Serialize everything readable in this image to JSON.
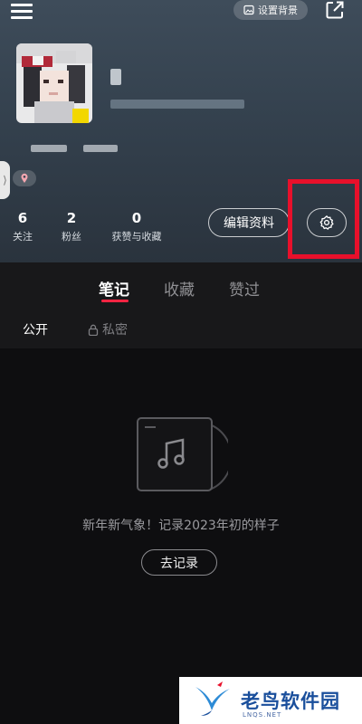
{
  "header": {
    "background_button_label": "设置背景",
    "menu_icon": "hamburger-menu-icon",
    "share_icon": "share-icon"
  },
  "stats": [
    {
      "value": "6",
      "label": "关注"
    },
    {
      "value": "2",
      "label": "粉丝"
    },
    {
      "value": "0",
      "label": "获赞与收藏"
    }
  ],
  "actions": {
    "edit_profile_label": "编辑资料",
    "settings_icon": "gear-icon"
  },
  "tabs": [
    {
      "label": "笔记",
      "active": true
    },
    {
      "label": "收藏",
      "active": false
    },
    {
      "label": "赞过",
      "active": false
    }
  ],
  "subtabs": [
    {
      "label": "公开",
      "active": true
    },
    {
      "label": "私密",
      "active": false,
      "icon": "lock-icon"
    }
  ],
  "empty_state": {
    "message": "新年新气象！记录2023年初的样子",
    "button_label": "去记录",
    "icon": "music-album-icon"
  },
  "watermark": {
    "text": "老鸟软件园",
    "subtext": "LNQS.NET"
  },
  "colors": {
    "accent": "#ff2442",
    "highlight_box": "#e8102b",
    "header_bg": "#3a4653",
    "content_bg": "#0e0e10"
  }
}
